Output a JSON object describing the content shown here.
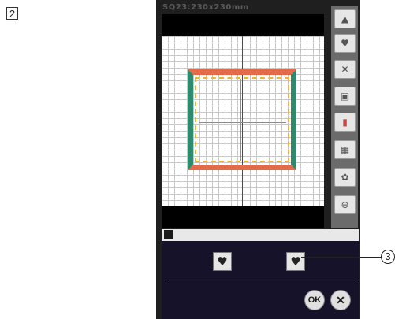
{
  "step_number": "2",
  "screen": {
    "title": "SQ23:230x230mm"
  },
  "side_toolbar": {
    "scroll_up_icon": "triangle-up",
    "buttons": [
      {
        "name": "layout-icon",
        "glyph": "♥"
      },
      {
        "name": "arrange-icon",
        "glyph": "✕"
      },
      {
        "name": "copy-icon",
        "glyph": "▣"
      },
      {
        "name": "color-icon",
        "glyph": "▮"
      },
      {
        "name": "grid-icon",
        "glyph": "▦"
      },
      {
        "name": "group-icon",
        "glyph": "✿"
      },
      {
        "name": "zoom-icon",
        "glyph": "⊕"
      }
    ]
  },
  "options_panel": {
    "header_icon": "hearts-icon",
    "option_1_glyph": "♥",
    "option_2_glyph": "♥",
    "ok_label": "OK",
    "cancel_label": "✕"
  },
  "callout_label": "3",
  "colors": {
    "accent_blue": "#3a3ad8",
    "accent_green": "#4fb84f",
    "frame_green": "#2d8a6e",
    "frame_orange": "#e56a4a",
    "frame_yellow": "#f0b432"
  }
}
